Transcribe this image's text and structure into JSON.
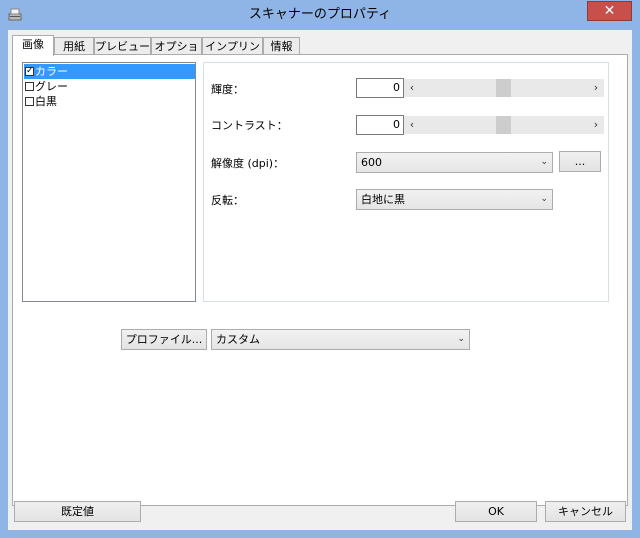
{
  "window": {
    "title": "スキャナーのプロパティ",
    "close_glyph": "✕"
  },
  "tabs": [
    {
      "label": "画像"
    },
    {
      "label": "用紙"
    },
    {
      "label": "プレビュー"
    },
    {
      "label": "オプション"
    },
    {
      "label": "インプリンター"
    },
    {
      "label": "情報"
    }
  ],
  "image_modes": [
    {
      "label": "カラー",
      "checked": true,
      "selected": true
    },
    {
      "label": "グレー",
      "checked": false,
      "selected": false
    },
    {
      "label": "白黒",
      "checked": false,
      "selected": false
    }
  ],
  "settings": {
    "brightness": {
      "label": "輝度：",
      "value": "0",
      "slider_fraction": 0.5
    },
    "contrast": {
      "label": "コントラスト：",
      "value": "0",
      "slider_fraction": 0.5
    },
    "resolution": {
      "label": "解像度 (dpi)：",
      "value": "600",
      "more_label": "..."
    },
    "invert": {
      "label": "反転：",
      "value": "白地に黒"
    },
    "scroll_left": "‹",
    "scroll_right": "›",
    "dropdown_arrow": "⌄"
  },
  "profile": {
    "button_label": "プロファイル...",
    "value": "カスタム"
  },
  "footer": {
    "default_label": "既定値",
    "ok_label": "OK",
    "cancel_label": "キャンセル"
  },
  "colors": {
    "title_bg": "#8fb5e6",
    "close": "#c7504a",
    "selection": "#3399ff"
  },
  "icons": {
    "app": "scanner-icon",
    "checkbox": "checkmark-icon"
  }
}
